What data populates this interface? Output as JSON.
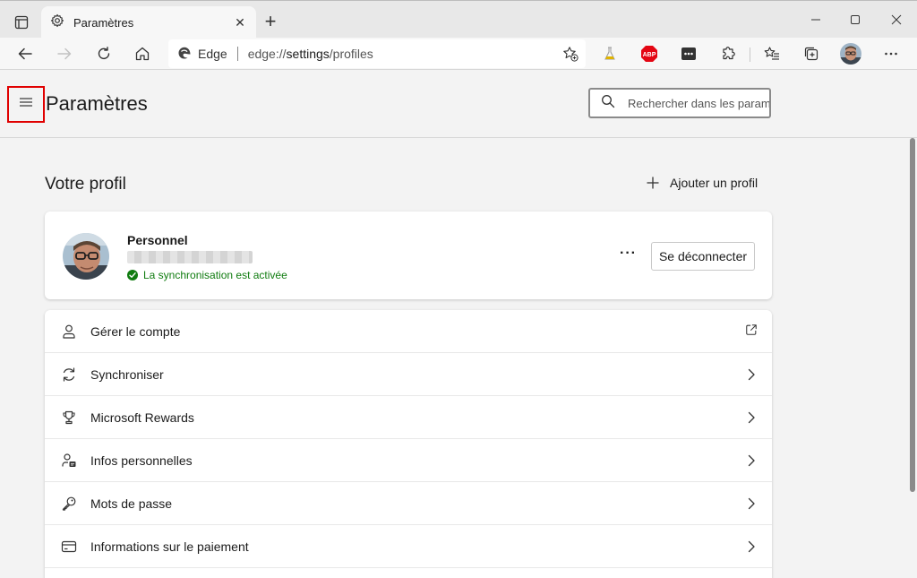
{
  "browser": {
    "tab_title": "Paramètres",
    "tab_close": "✕",
    "new_tab": "+",
    "address_brand": "Edge",
    "address_url_prefix": "edge://",
    "address_url_path": "settings",
    "address_url_suffix": "/profiles",
    "extensions": [
      {
        "name": "flask-extension",
        "color": "#c8a400"
      },
      {
        "name": "adblock-plus",
        "label": "ABP",
        "color": "#e40613"
      },
      {
        "name": "password-extension",
        "label": "•••",
        "color": "#333333"
      }
    ]
  },
  "settings": {
    "page_title": "Paramètres",
    "search_placeholder": "Rechercher dans les paramètres"
  },
  "profile": {
    "section_title": "Votre profil",
    "add_profile_label": "Ajouter un profil",
    "name": "Personnel",
    "sync_status": "La synchronisation est activée",
    "more_label": "···",
    "signout_label": "Se déconnecter"
  },
  "items": [
    {
      "label": "Gérer le compte",
      "icon": "person-icon",
      "trail": "external-link-icon"
    },
    {
      "label": "Synchroniser",
      "icon": "sync-icon",
      "trail": "chevron-right-icon"
    },
    {
      "label": "Microsoft Rewards",
      "icon": "trophy-icon",
      "trail": "chevron-right-icon"
    },
    {
      "label": "Infos personnelles",
      "icon": "person-card-icon",
      "trail": "chevron-right-icon"
    },
    {
      "label": "Mots de passe",
      "icon": "key-icon",
      "trail": "chevron-right-icon"
    },
    {
      "label": "Informations sur le paiement",
      "icon": "credit-card-icon",
      "trail": "chevron-right-icon"
    }
  ],
  "colors": {
    "accent_highlight": "#e00000",
    "sync_green": "#107c10"
  }
}
